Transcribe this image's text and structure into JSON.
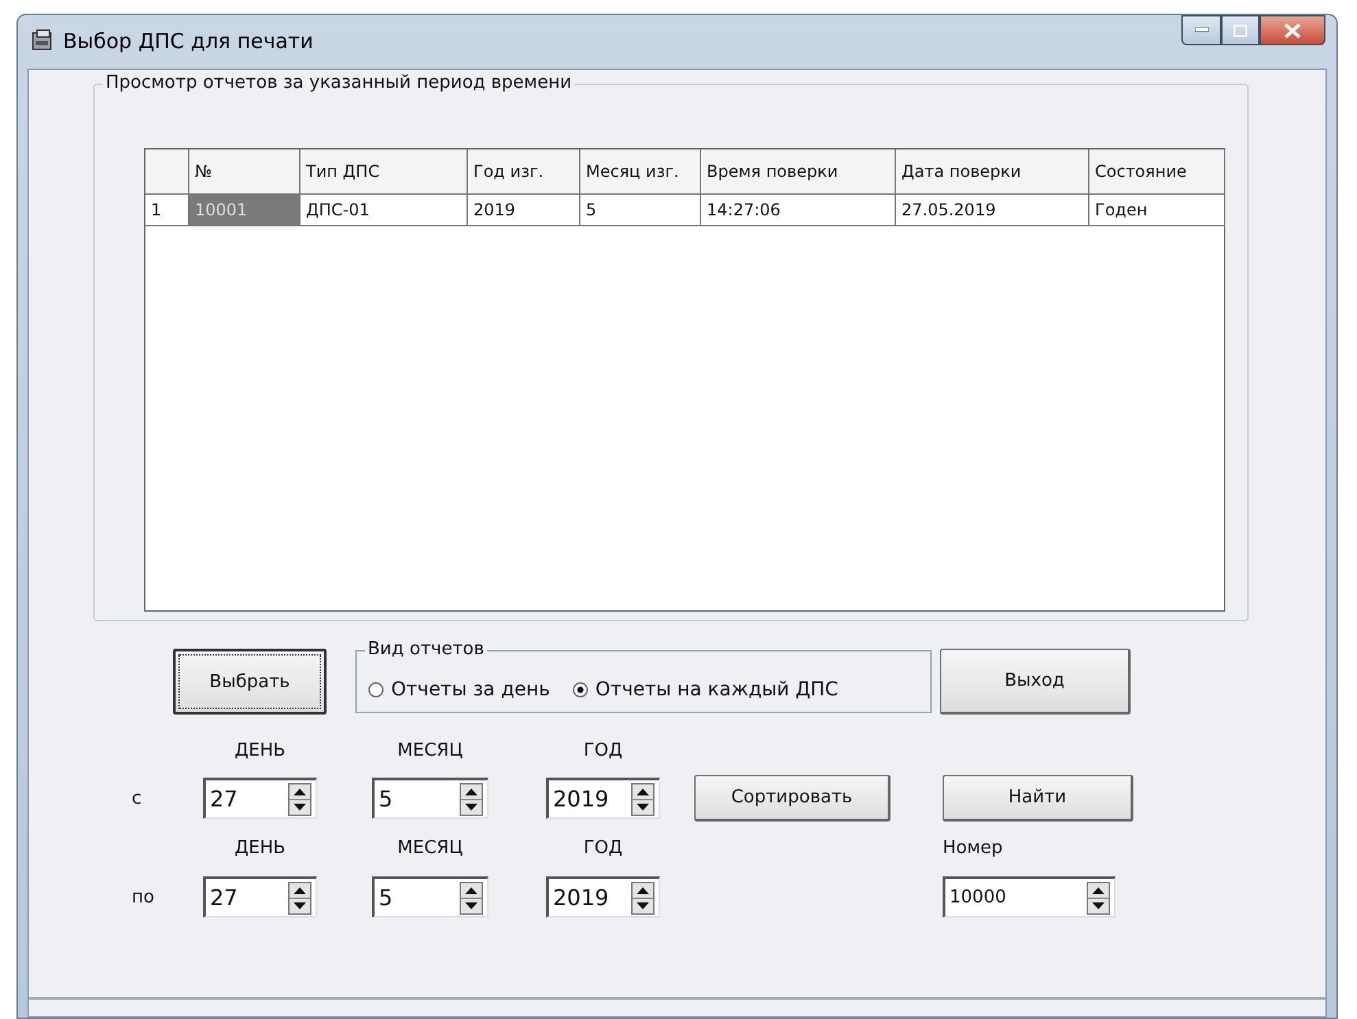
{
  "window": {
    "title": "Выбор ДПС для печати"
  },
  "report_group": {
    "title": "Просмотр отчетов за указанный период времени"
  },
  "table": {
    "columns": [
      "№",
      "Тип ДПС",
      "Год изг.",
      "Месяц изг.",
      "Время поверки",
      "Дата поверки",
      "Состояние"
    ],
    "rows": [
      {
        "row_header": "1",
        "cells": [
          {
            "text": "10001",
            "selected": true
          },
          {
            "text": "ДПС-01",
            "selected": false
          },
          {
            "text": "2019",
            "selected": false
          },
          {
            "text": "5",
            "selected": false
          },
          {
            "text": "14:27:06",
            "selected": false
          },
          {
            "text": "27.05.2019",
            "selected": false
          },
          {
            "text": "Годен",
            "selected": false
          }
        ]
      }
    ]
  },
  "select_button": "Выбрать",
  "report_type": {
    "title": "Вид отчетов",
    "options": [
      {
        "label": "Отчеты за день",
        "selected": false
      },
      {
        "label": "Отчеты на каждый ДПС",
        "selected": true
      }
    ]
  },
  "exit_button": "Выход",
  "date_rows": [
    {
      "label": "с",
      "fields": [
        {
          "label": "ДЕНЬ",
          "value": "27"
        },
        {
          "label": "МЕСЯЦ",
          "value": "5"
        },
        {
          "label": "ГОД",
          "value": "2019"
        }
      ]
    },
    {
      "label": "по",
      "fields": [
        {
          "label": "ДЕНЬ",
          "value": "27"
        },
        {
          "label": "МЕСЯЦ",
          "value": "5"
        },
        {
          "label": "ГОД",
          "value": "2019"
        }
      ]
    }
  ],
  "sort_button": "Сортировать",
  "find_button": "Найти",
  "number": {
    "label": "Номер",
    "value": "10000"
  }
}
